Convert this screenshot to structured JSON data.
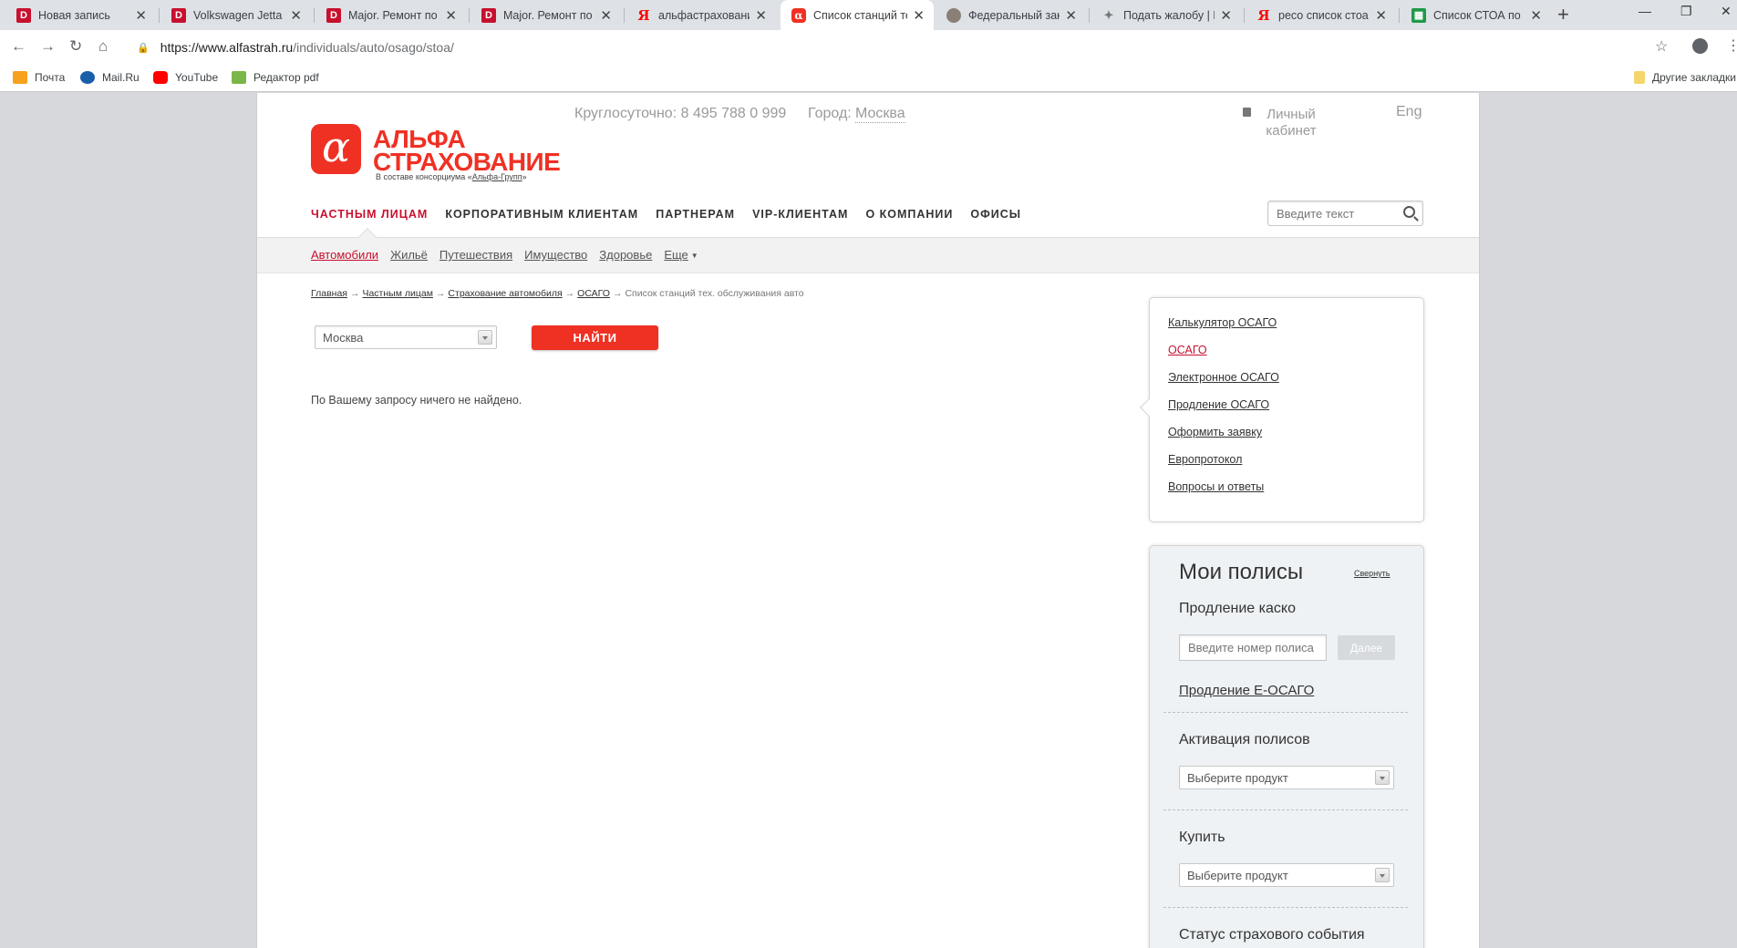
{
  "tabs": [
    {
      "label": "Новая запись",
      "icon": "d-icon"
    },
    {
      "label": "Volkswagen Jetta",
      "icon": "d-icon"
    },
    {
      "label": "Major. Ремонт по С",
      "icon": "d-icon"
    },
    {
      "label": "Major. Ремонт по С",
      "icon": "d-icon"
    },
    {
      "label": "альфастрахование",
      "icon": "yandex-icon"
    },
    {
      "label": "Список станций те",
      "icon": "alfa-icon"
    },
    {
      "label": "Федеральный зако",
      "icon": "federal-icon"
    },
    {
      "label": "Подать жалобу | Ба",
      "icon": "eagle-icon"
    },
    {
      "label": "ресо список стоа п",
      "icon": "yandex-icon"
    },
    {
      "label": "Список СТОА по н",
      "icon": "excel-icon"
    }
  ],
  "address_bar": {
    "host": "https://www.alfastrah.ru",
    "path": "/individuals/auto/osago/stoa/"
  },
  "bookmarks": {
    "items": [
      "Почта",
      "Mail.Ru",
      "YouTube",
      "Редактор pdf"
    ],
    "other": "Другие закладки"
  },
  "header": {
    "phone": "Круглосуточно: 8 495 788 0 999",
    "city_label": "Город:",
    "city": "Москва",
    "cabinet": "Личный кабинет",
    "lang": "Eng"
  },
  "logo": {
    "line1": "АЛЬФА",
    "line2": "СТРАХОВАНИЕ",
    "sub_prefix": "В составе консорциума «",
    "sub_link": "Альфа-Групп",
    "sub_suffix": "»"
  },
  "main_nav": [
    "ЧАСТНЫМ ЛИЦАМ",
    "КОРПОРАТИВНЫМ КЛИЕНТАМ",
    "ПАРТНЕРАМ",
    "VIP-КЛИЕНТАМ",
    "О КОМПАНИИ",
    "ОФИСЫ"
  ],
  "search": {
    "placeholder": "Введите текст"
  },
  "sub_nav": [
    "Автомобили",
    "Жильё",
    "Путешествия",
    "Имущество",
    "Здоровье",
    "Еще"
  ],
  "breadcrumb": {
    "links": [
      "Главная",
      "Частным лицам",
      "Страхование автомобиля",
      "ОСАГО"
    ],
    "current": "Список станций тех. обслуживания авто",
    "separator": "→"
  },
  "filter": {
    "city": "Москва",
    "button": "НАЙТИ"
  },
  "no_results": "По Вашему запросу ничего не найдено.",
  "side_menu": [
    "Калькулятор ОСАГО",
    "ОСАГО",
    "Электронное ОСАГО",
    "Продление ОСАГО",
    "Оформить заявку",
    "Европротокол",
    "Вопросы и ответы"
  ],
  "policies": {
    "title": "Мои полисы",
    "collapse": "Свернуть",
    "renewal_title": "Продление каско",
    "policy_placeholder": "Введите номер полиса",
    "next_button": "Далее",
    "eosago_link": "Продление Е-ОСАГО",
    "activation_title": "Активация полисов",
    "product_select": "Выберите продукт",
    "buy_title": "Купить",
    "status_title": "Статус страхового события"
  },
  "colors": {
    "brand": "#ef3124",
    "active_link": "#c8102e"
  }
}
